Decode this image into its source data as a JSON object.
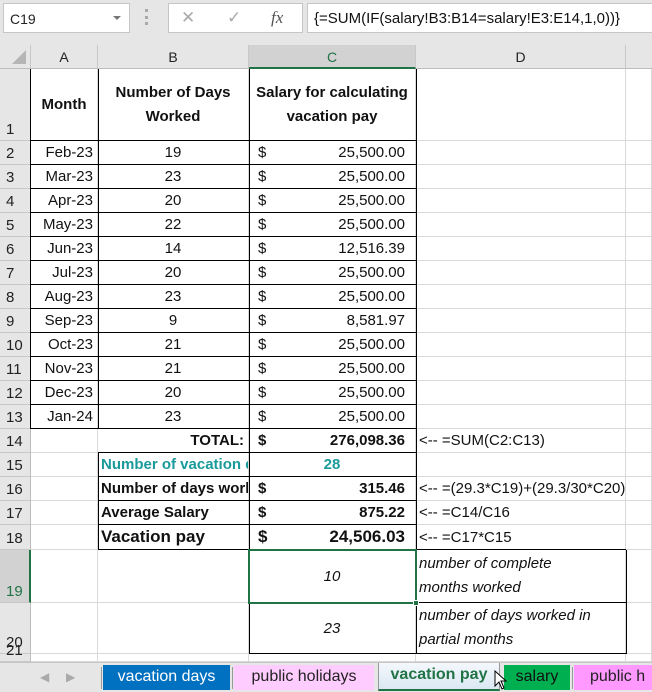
{
  "formula_bar": {
    "name_box": "C19",
    "cancel_icon": "✕",
    "enter_icon": "✓",
    "fx_label": "fx",
    "formula": "{=SUM(IF(salary!B3:B14=salary!E3:E14,1,0))}"
  },
  "columns": [
    "A",
    "B",
    "C",
    "D"
  ],
  "rows": [
    "1",
    "2",
    "3",
    "4",
    "5",
    "6",
    "7",
    "8",
    "9",
    "10",
    "11",
    "12",
    "13",
    "14",
    "15",
    "16",
    "17",
    "18",
    "19",
    "20",
    "21"
  ],
  "header": {
    "month": "Month",
    "days_line1": "Number of Days",
    "days_line2": "Worked",
    "salary_line1": "Salary for calculating",
    "salary_line2": "vacation pay"
  },
  "currency_symbol": "$",
  "data_rows": [
    {
      "month": "Feb-23",
      "days": "19",
      "salary": "25,500.00"
    },
    {
      "month": "Mar-23",
      "days": "23",
      "salary": "25,500.00"
    },
    {
      "month": "Apr-23",
      "days": "20",
      "salary": "25,500.00"
    },
    {
      "month": "May-23",
      "days": "22",
      "salary": "25,500.00"
    },
    {
      "month": "Jun-23",
      "days": "14",
      "salary": "12,516.39"
    },
    {
      "month": "Jul-23",
      "days": "20",
      "salary": "25,500.00"
    },
    {
      "month": "Aug-23",
      "days": "23",
      "salary": "25,500.00"
    },
    {
      "month": "Sep-23",
      "days": "9",
      "salary": "8,581.97"
    },
    {
      "month": "Oct-23",
      "days": "21",
      "salary": "25,500.00"
    },
    {
      "month": "Nov-23",
      "days": "21",
      "salary": "25,500.00"
    },
    {
      "month": "Dec-23",
      "days": "20",
      "salary": "25,500.00"
    },
    {
      "month": "Jan-24",
      "days": "23",
      "salary": "25,500.00"
    }
  ],
  "summary": {
    "total_label": "TOTAL:",
    "total_value": "276,098.36",
    "total_note": "<-- =SUM(C2:C13)",
    "vacation_days_label": "Number of vacation days",
    "vacation_days_value": "28",
    "days_worked_label": "Number of days worked",
    "days_worked_value": "315.46",
    "days_worked_note": "<-- =(29.3*C19)+(29.3/30*C20)",
    "avg_salary_label": "Average Salary",
    "avg_salary_value": "875.22",
    "avg_salary_note": "<-- =C14/C16",
    "vacation_pay_label": "Vacation pay",
    "vacation_pay_value": "24,506.03",
    "vacation_pay_note": "<-- =C17*C15"
  },
  "extra": {
    "complete_months_value": "10",
    "complete_months_line1": "number of complete",
    "complete_months_line2": "months worked",
    "partial_days_value": "23",
    "partial_days_line1": "number of days worked in",
    "partial_days_line2": "partial months"
  },
  "tabs": [
    {
      "label": "vacation days",
      "color": "#0070c0",
      "text_color": "#ffffff"
    },
    {
      "label": "public holidays",
      "color": "#ffccff",
      "text_color": "#222222"
    },
    {
      "label": "vacation pay",
      "color": "#dbe8f4",
      "text_color": "#217346",
      "active": true
    },
    {
      "label": "salary",
      "color": "#00b050",
      "text_color": "#111111"
    },
    {
      "label": "public h",
      "color": "#ff99ff",
      "text_color": "#222222"
    }
  ],
  "colors": {
    "selection": "#217346",
    "accent_teal": "#1a9a9a"
  }
}
